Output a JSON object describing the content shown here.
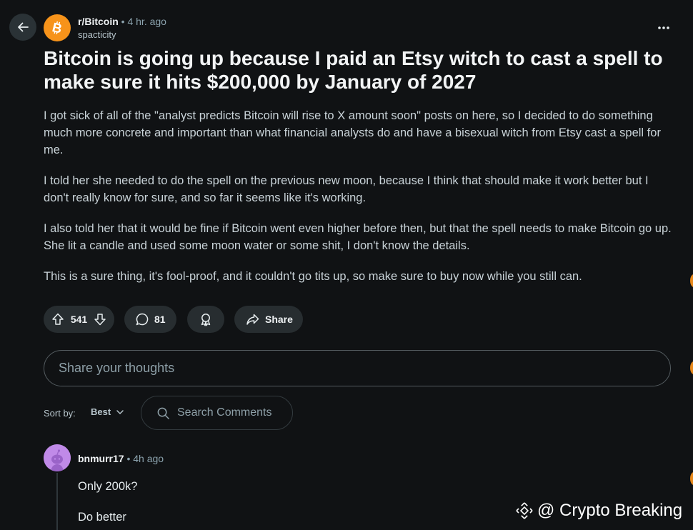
{
  "header": {
    "subreddit": "r/Bitcoin",
    "separator": "•",
    "time": "4 hr. ago",
    "author": "spacticity"
  },
  "post": {
    "title": "Bitcoin is going up because I paid an Etsy witch to cast a spell to make sure it hits $200,000 by January of 2027",
    "paragraphs": [
      "I got sick of all of the \"analyst predicts Bitcoin will rise to X amount soon\" posts on here, so I decided to do something much more concrete and important than what financial analysts do and have a bisexual witch from Etsy cast a spell for me.",
      "I told her she needed to do the spell on the previous new moon, because I think that should make it work better but I don't really know for sure, and so far it seems like it's working.",
      "I also told her that it would be fine if Bitcoin went even higher before then, but that the spell needs to make Bitcoin go up. She lit a candle and used some moon water or some shit, I don't know the details.",
      "This is a sure thing, it's fool-proof, and it couldn't go tits up, so make sure to buy now while you still can."
    ]
  },
  "actions": {
    "votes": "541",
    "comments": "81",
    "share_label": "Share"
  },
  "composer": {
    "placeholder": "Share your thoughts"
  },
  "sort": {
    "label": "Sort by:",
    "selected": "Best",
    "search_placeholder": "Search Comments"
  },
  "comment": {
    "author": "bnmurr17",
    "separator": "•",
    "time": "4h ago",
    "paragraphs": [
      "Only 200k?",
      "Do better"
    ]
  },
  "watermark": {
    "text": "@ Crypto Breaking"
  },
  "colors": {
    "background": "#101214",
    "bitcoin_orange": "#f7931a",
    "pill": "#272d30",
    "avatar_purple": "#c08ae8"
  },
  "icons": {
    "back": "arrow-left-icon",
    "subreddit": "bitcoin-logo-icon",
    "more": "more-horizontal-icon",
    "upvote": "upvote-icon",
    "downvote": "downvote-icon",
    "comment": "comment-icon",
    "award": "award-icon",
    "share": "share-icon",
    "search": "search-icon",
    "chevron": "chevron-down-icon",
    "watermark": "binance-logo-icon"
  }
}
